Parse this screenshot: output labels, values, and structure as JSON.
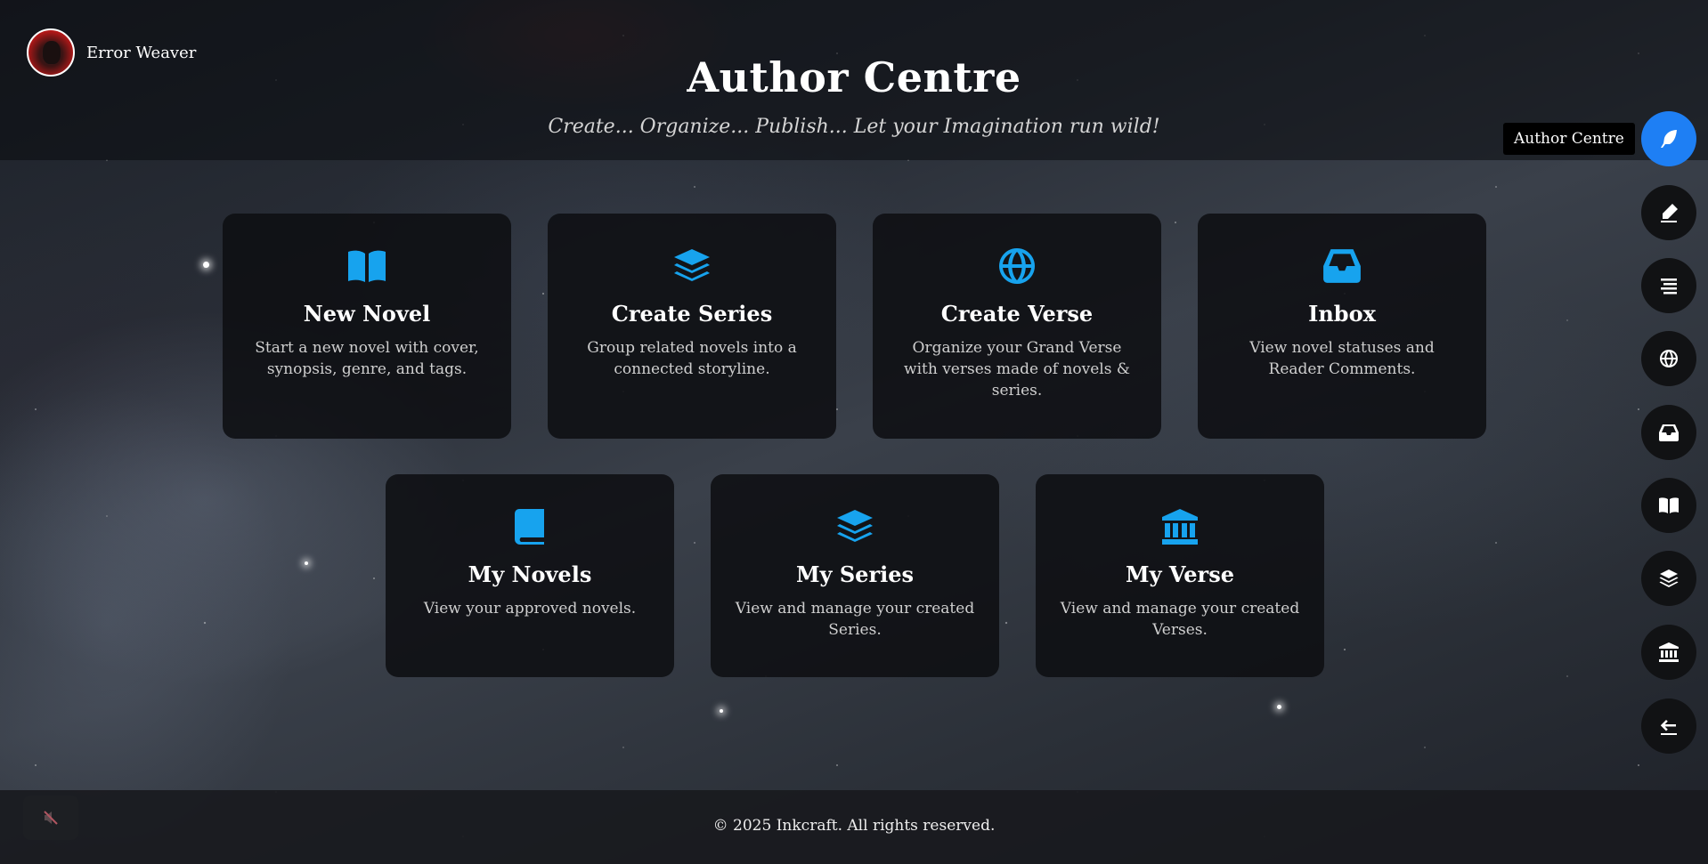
{
  "user": {
    "name": "Error Weaver"
  },
  "header": {
    "title": "Author Centre",
    "subtitle": "Create... Organize... Publish... Let your Imagination run wild!"
  },
  "cards": [
    {
      "icon": "open-book-icon",
      "title": "New Novel",
      "description": "Start a new novel with cover, synopsis, genre, and tags."
    },
    {
      "icon": "layers-icon",
      "title": "Create Series",
      "description": "Group related novels into a connected storyline."
    },
    {
      "icon": "globe-icon",
      "title": "Create Verse",
      "description": "Organize your Grand Verse with verses made of novels & series."
    },
    {
      "icon": "inbox-icon",
      "title": "Inbox",
      "description": "View novel statuses and Reader Comments."
    },
    {
      "icon": "book-icon",
      "title": "My Novels",
      "description": "View your approved novels."
    },
    {
      "icon": "layers-icon",
      "title": "My Series",
      "description": "View and manage your created Series."
    },
    {
      "icon": "institution-icon",
      "title": "My Verse",
      "description": "View and manage your created Verses."
    }
  ],
  "sidebar": {
    "tooltip": "Author Centre",
    "items": [
      {
        "icon": "feather-icon",
        "active": true
      },
      {
        "icon": "pen-icon"
      },
      {
        "icon": "list-icon"
      },
      {
        "icon": "globe-icon"
      },
      {
        "icon": "inbox-icon"
      },
      {
        "icon": "open-book-icon"
      },
      {
        "icon": "layers-icon"
      },
      {
        "icon": "institution-icon"
      },
      {
        "icon": "back-arrow-icon"
      }
    ],
    "accent": "#1e7ff4"
  },
  "footer": {
    "copyright": "© 2025 Inkcraft. All rights reserved."
  },
  "colors": {
    "icon_accent": "#17a3ee"
  }
}
